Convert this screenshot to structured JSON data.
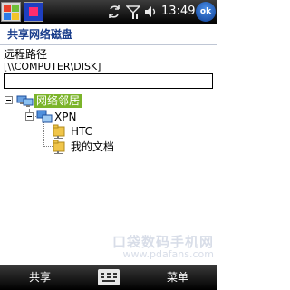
{
  "status_bar": {
    "time": "13:49",
    "ok_label": "ok",
    "icons": [
      "windows-start-icon",
      "app-icon",
      "sync-icon",
      "signal-icon",
      "volume-icon"
    ]
  },
  "title": "共享网络磁盘",
  "path": {
    "label": "远程路径",
    "hint": "[\\\\COMPUTER\\DISK]",
    "value": ""
  },
  "tree": {
    "root": {
      "label": "网络邻居",
      "selected": true
    },
    "group": {
      "label": "XPN"
    },
    "children": [
      {
        "label": "HTC"
      },
      {
        "label": "我的文档"
      }
    ]
  },
  "watermark": {
    "title": "口袋数码手机网",
    "url": "www.pdafans.com"
  },
  "softkeys": {
    "left": "共享",
    "right": "菜单"
  },
  "colors": {
    "title_text": "#1a3e8c",
    "selection": "#7bb42a",
    "softbar": "#000000"
  }
}
